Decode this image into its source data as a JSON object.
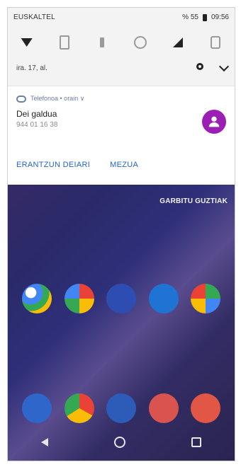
{
  "status": {
    "carrier": "EUSKALTEL",
    "battery_text": "% 55",
    "time": "09:56"
  },
  "quick_settings": {
    "date": "ira. 17, al."
  },
  "notification": {
    "app_line": "Telefonoa • orain ∨",
    "title": "Dei galdua",
    "number": "944 01 16 38",
    "actions": {
      "call_back": "ERANTZUN DEIARI",
      "message": "MEZUA"
    }
  },
  "home": {
    "clear_all": "GARBITU GUZTIAK"
  },
  "colors": {
    "accent_blue": "#2364c8",
    "avatar_purple": "#9b1fb4",
    "home_dark": "#2a2a6a"
  }
}
